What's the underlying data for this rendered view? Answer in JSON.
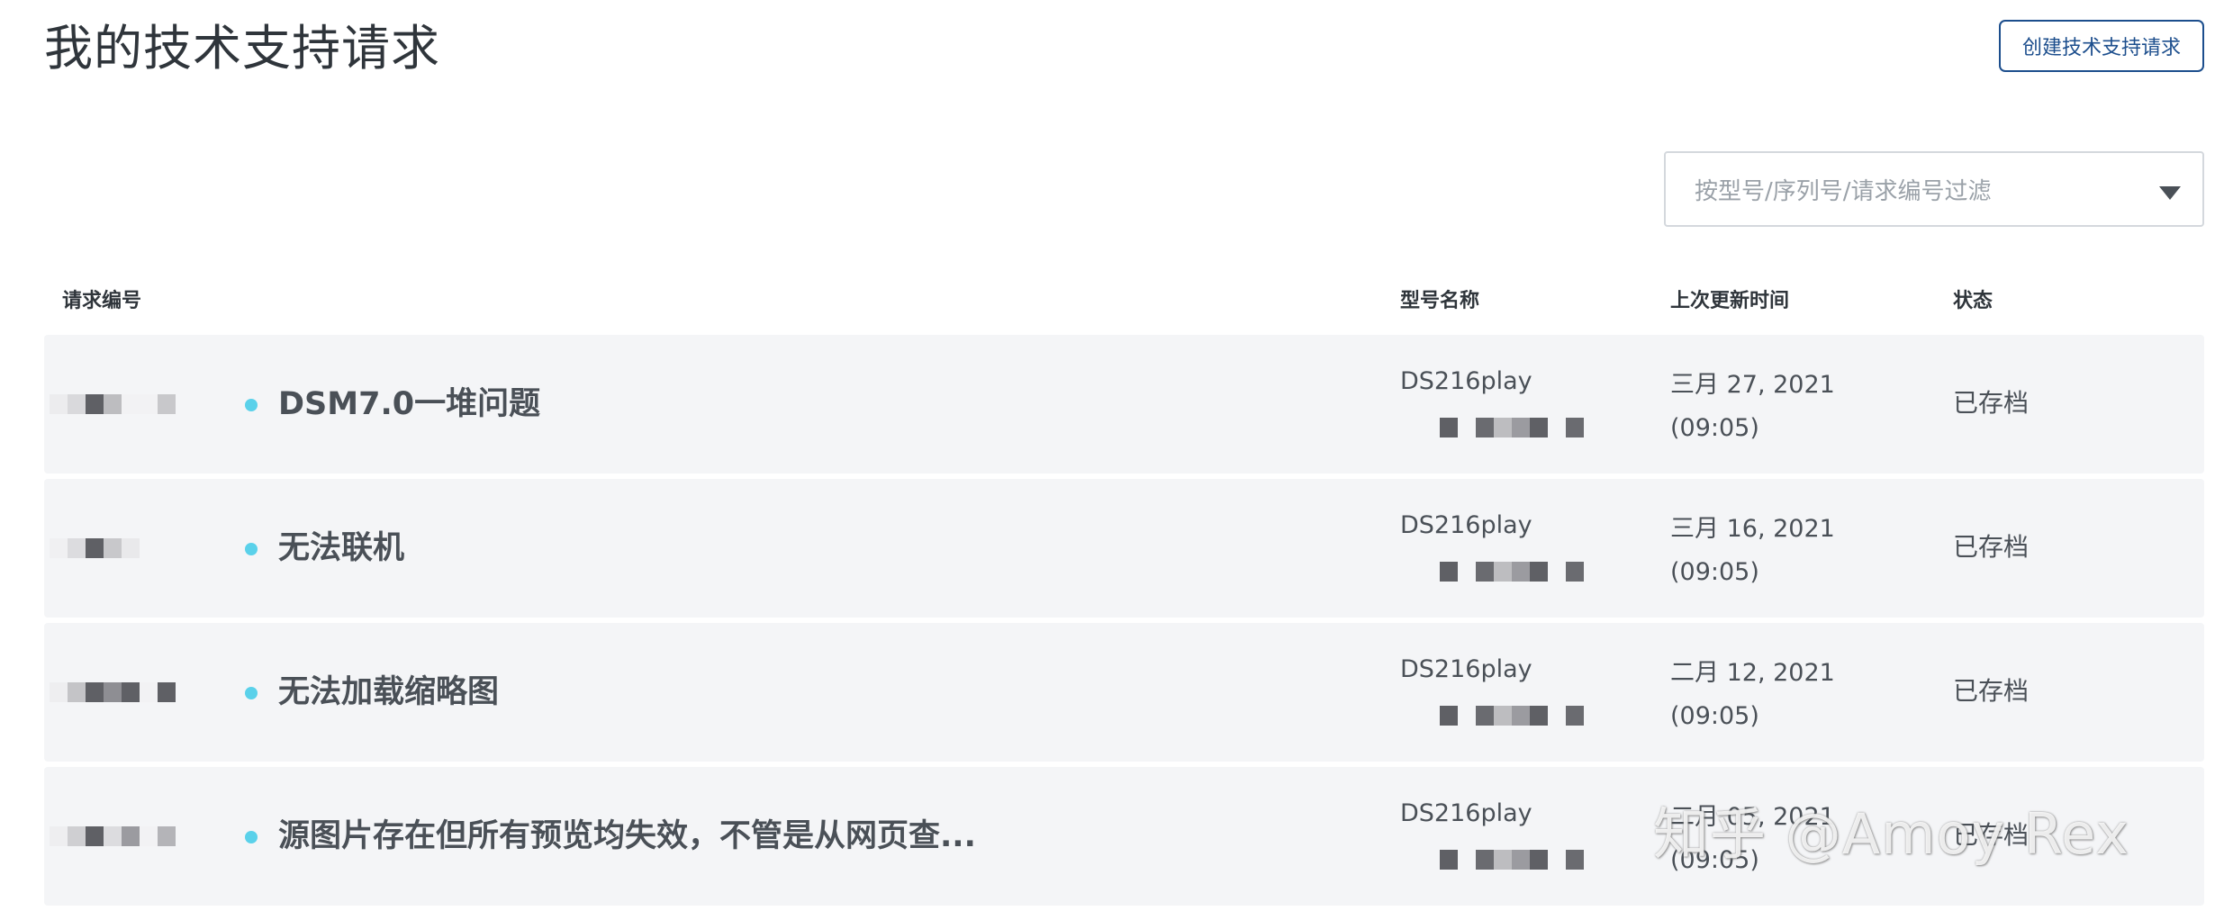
{
  "header": {
    "title": "我的技术支持请求",
    "create_button_label": "创建技术支持请求"
  },
  "filter": {
    "placeholder": "按型号/序列号/请求编号过滤",
    "arrow_icon": "caret-down-icon"
  },
  "table": {
    "columns": [
      "请求编号",
      "型号名称",
      "上次更新时间",
      "状态"
    ],
    "rows": [
      {
        "subject": "DSM7.0一堆问题",
        "model": "DS216play",
        "updated_date": "三月 27, 2021",
        "updated_time": "(09:05)",
        "status": "已存档"
      },
      {
        "subject": "无法联机",
        "model": "DS216play",
        "updated_date": "三月 16, 2021",
        "updated_time": "(09:05)",
        "status": "已存档"
      },
      {
        "subject": "无法加载缩略图",
        "model": "DS216play",
        "updated_date": "二月 12, 2021",
        "updated_time": "(09:05)",
        "status": "已存档"
      },
      {
        "subject": "源图片存在但所有预览均失效，不管是从网页查...",
        "model": "DS216play",
        "updated_date": "二月 05, 2021",
        "updated_time": "(09:05)",
        "status": "已存档"
      }
    ]
  },
  "watermark": "知乎 @Amoy Rex",
  "colors": {
    "accent": "#1c4e8d",
    "status_dot": "#5ad1ea",
    "row_background": "#f4f5f7"
  }
}
